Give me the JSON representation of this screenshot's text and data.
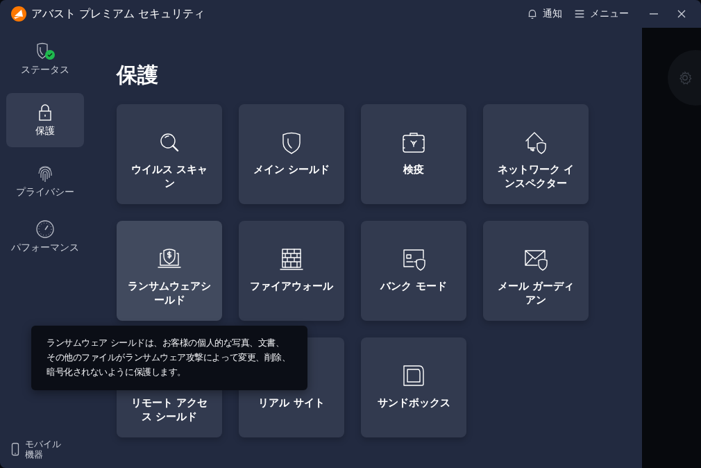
{
  "window": {
    "title": "アバスト プレミアム セキュリティ"
  },
  "header_actions": [
    {
      "label": "通知"
    },
    {
      "label": "メニュー"
    }
  ],
  "sidebar": {
    "items": [
      {
        "label": "ステータス",
        "selected": false
      },
      {
        "label": "保護",
        "selected": true
      },
      {
        "label": "プライバシー",
        "selected": false
      },
      {
        "label": "パフォーマンス",
        "selected": false
      }
    ],
    "footer": {
      "label": "モバイル機器"
    }
  },
  "page": {
    "title": "保護"
  },
  "tiles": [
    {
      "label": "ウイルス スキャン",
      "hovered": false
    },
    {
      "label": "メイン シールド",
      "hovered": false
    },
    {
      "label": "検疫",
      "hovered": false
    },
    {
      "label": "ネットワーク インスペクター",
      "hovered": false
    },
    {
      "label": "ランサムウェアシールド",
      "hovered": true
    },
    {
      "label": "ファイアウォール",
      "hovered": false
    },
    {
      "label": "バンク モード",
      "hovered": false
    },
    {
      "label": "メール ガーディアン",
      "hovered": false
    },
    {
      "label": "リモート アクセス シールド",
      "hovered": false
    },
    {
      "label": "リアル サイト",
      "hovered": false
    },
    {
      "label": "サンドボックス",
      "hovered": false
    }
  ],
  "tooltip": {
    "text": "ランサムウェア シールドは、お客様の個人的な写真、文書、その他のファイルがランサムウェア攻撃によって変更、削除、暗号化されないように保護します。"
  }
}
